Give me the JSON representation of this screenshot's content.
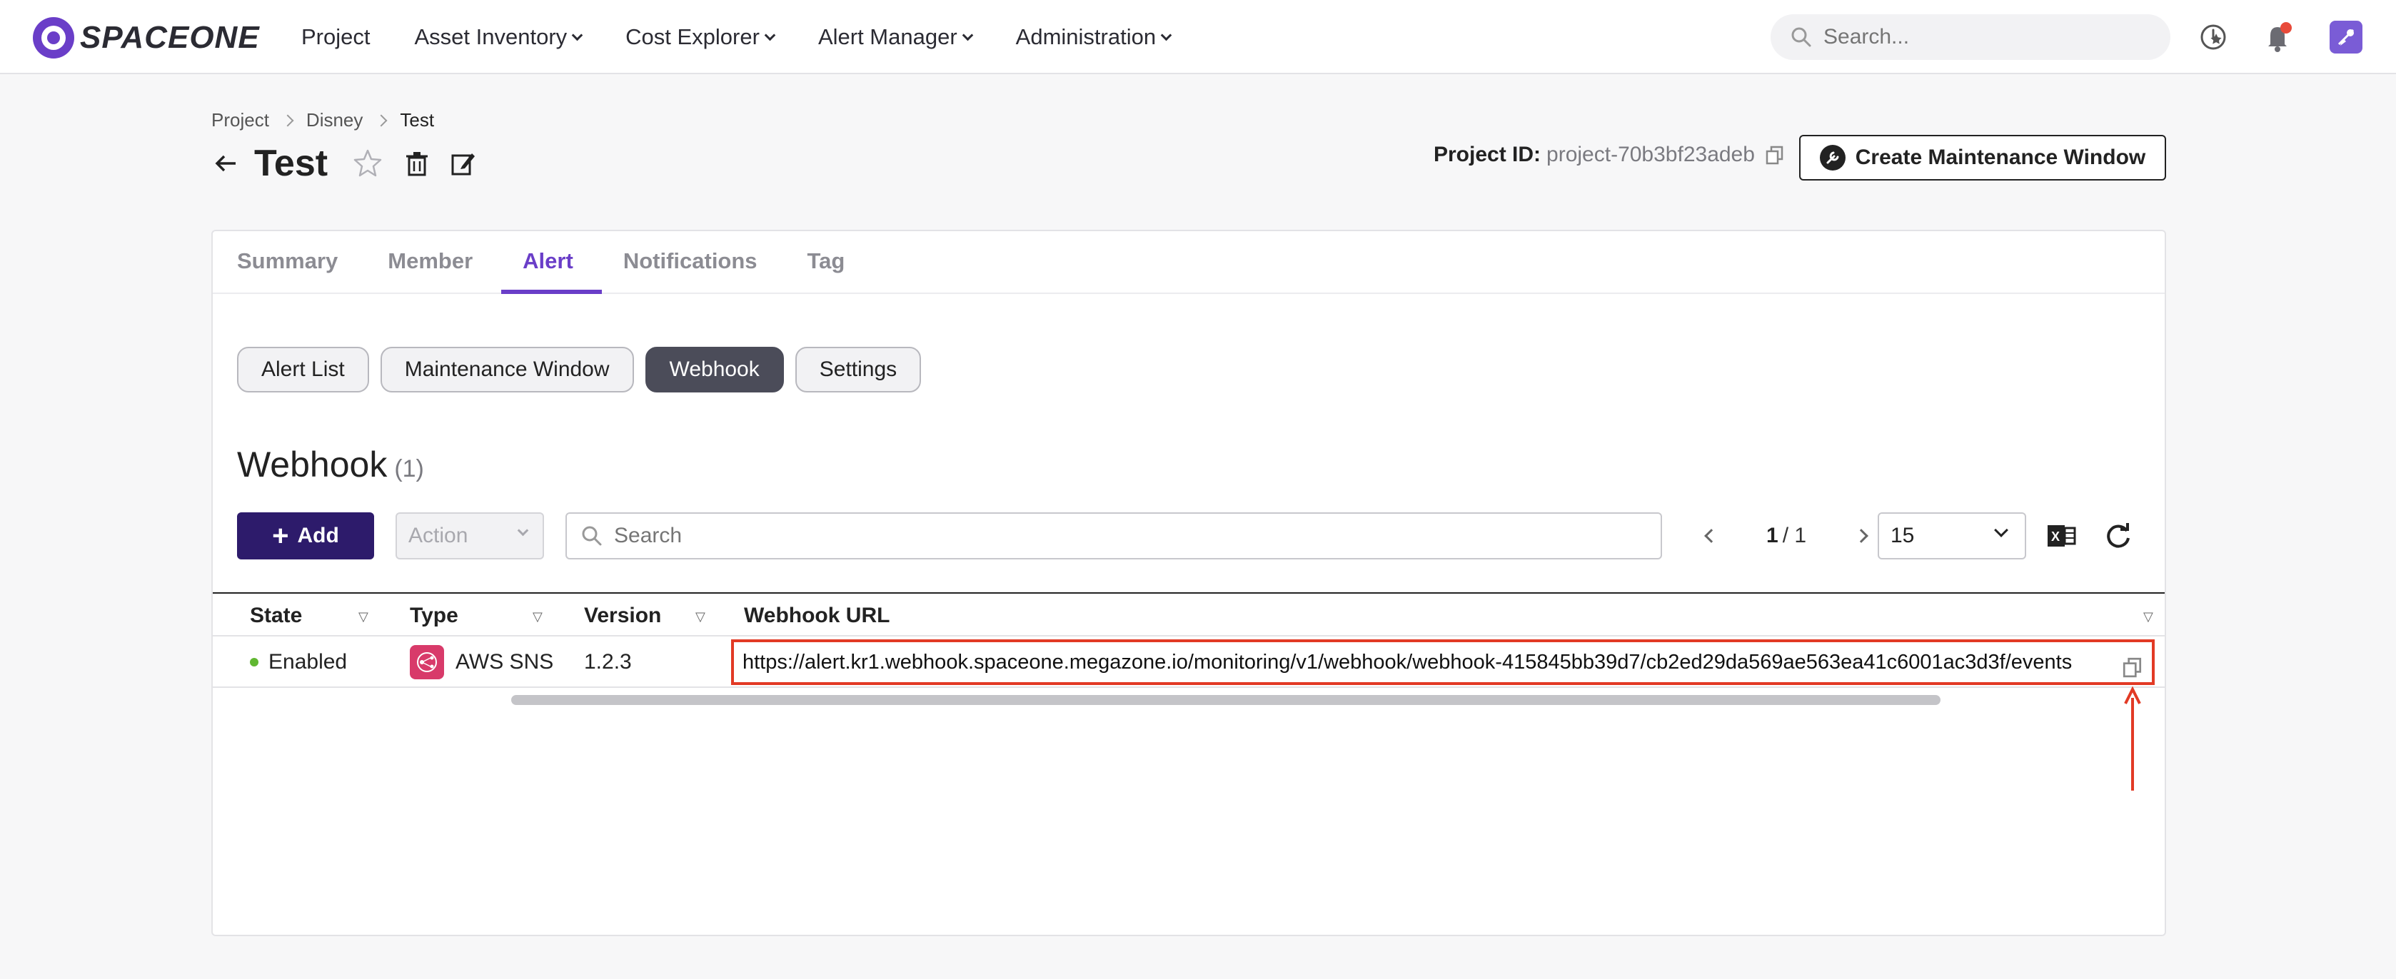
{
  "app": {
    "logo_text": "SPACEONE",
    "brand_color": "#6a3ec8"
  },
  "nav": {
    "items": [
      {
        "label": "Project",
        "dropdown": false
      },
      {
        "label": "Asset Inventory",
        "dropdown": true
      },
      {
        "label": "Cost Explorer",
        "dropdown": true
      },
      {
        "label": "Alert Manager",
        "dropdown": true
      },
      {
        "label": "Administration",
        "dropdown": true
      }
    ],
    "search_placeholder": "Search...",
    "icons": [
      "history-icon",
      "notification-bell-icon",
      "user-avatar-icon"
    ]
  },
  "breadcrumb": [
    "Project",
    "Disney",
    "Test"
  ],
  "page": {
    "title": "Test",
    "project_id_label": "Project ID:",
    "project_id_value": "project-70b3bf23adeb",
    "create_mw_label": "Create Maintenance Window"
  },
  "tabs": [
    {
      "label": "Summary",
      "active": false
    },
    {
      "label": "Member",
      "active": false
    },
    {
      "label": "Alert",
      "active": true
    },
    {
      "label": "Notifications",
      "active": false
    },
    {
      "label": "Tag",
      "active": false
    }
  ],
  "subtabs": [
    {
      "label": "Alert List",
      "active": false
    },
    {
      "label": "Maintenance Window",
      "active": false
    },
    {
      "label": "Webhook",
      "active": true
    },
    {
      "label": "Settings",
      "active": false
    }
  ],
  "section": {
    "title": "Webhook",
    "count": "(1)"
  },
  "toolbar": {
    "add_label": "Add",
    "action_label": "Action",
    "search_placeholder": "Search",
    "page_current": "1",
    "page_total": "/ 1",
    "page_size": "15"
  },
  "table": {
    "columns": [
      "State",
      "Type",
      "Version",
      "Webhook URL"
    ],
    "rows": [
      {
        "state": "Enabled",
        "type": "AWS SNS",
        "version": "1.2.3",
        "url": "https://alert.kr1.webhook.spaceone.megazone.io/monitoring/v1/webhook/webhook-415845bb39d7/cb2ed29da569ae563ea41c6001ac3d3f/events"
      }
    ]
  },
  "colors": {
    "accent": "#6a3ec8",
    "primary_button": "#2d1b6b",
    "highlight_border": "#e23a25",
    "enabled_dot": "#60b731",
    "sns_icon_bg": "#d83a6a"
  }
}
